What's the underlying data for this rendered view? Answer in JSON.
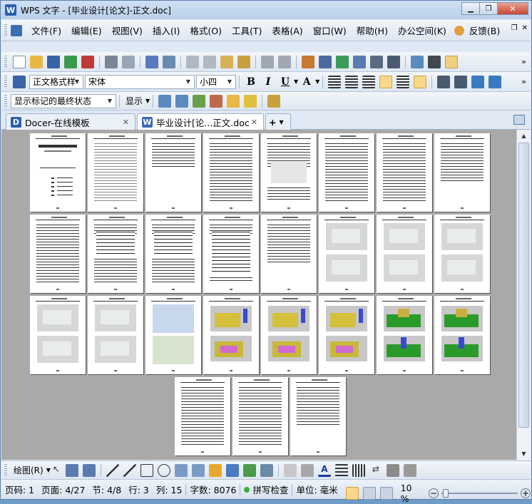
{
  "window": {
    "title": "WPS 文字 - [毕业设计[论文]-正文.doc]",
    "app_icon": "W"
  },
  "menubar": {
    "items": [
      "文件(F)",
      "编辑(E)",
      "视图(V)",
      "插入(I)",
      "格式(O)",
      "工具(T)",
      "表格(A)",
      "窗口(W)",
      "帮助(H)",
      "办公空间(K)",
      "反馈(B)"
    ]
  },
  "format_toolbar": {
    "style": "正文格式样",
    "font": "宋体",
    "size": "小四",
    "bold": "B",
    "italic": "I",
    "underline": "U",
    "char_effect": "A"
  },
  "review_toolbar": {
    "markup_mode": "显示标记的最终状态",
    "show_label": "显示"
  },
  "tabs": [
    {
      "label": "Docer-在线模板",
      "icon": "D"
    },
    {
      "label": "毕业设计[论...正文.doc",
      "icon": "W"
    }
  ],
  "drawbar": {
    "draw_label": "绘图(R)"
  },
  "status": {
    "page_code": "页码: 1",
    "page": "页面: 4/27",
    "section": "节: 4/8",
    "row": "行: 3",
    "col": "列: 15",
    "words": "字数: 8076",
    "spell": "拼写检查",
    "unit": "单位: 毫米",
    "zoom": "10 %"
  },
  "colors": {
    "accent": "#2a5fb0",
    "doc_bg": "#a9a9a9",
    "status_green": "#3bb03b"
  }
}
